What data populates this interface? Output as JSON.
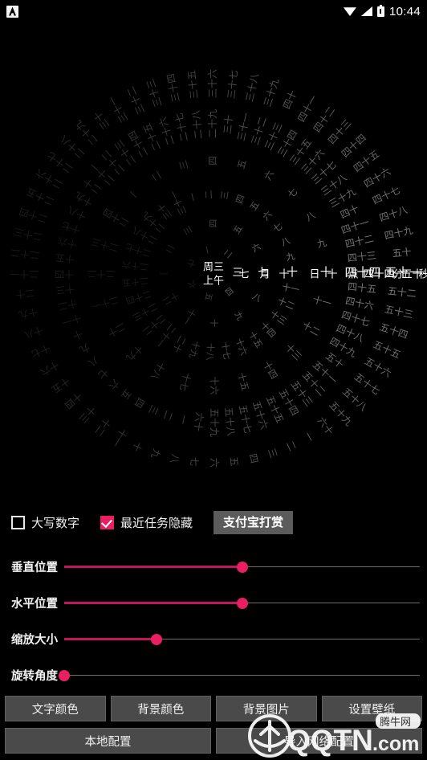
{
  "statusbar": {
    "app_icon": "app-notification-icon",
    "wifi_icon": "wifi-icon",
    "signal_icon": "signal-icon",
    "battery_icon": "battery-icon",
    "time": "10:44"
  },
  "clock": {
    "center_line1": "周三",
    "center_line2": "上午",
    "month_value": "七",
    "month_unit": "月",
    "day_value": "十",
    "day_unit": "日",
    "hour_value": "十",
    "hour_unit": "点",
    "minute_value": "四十四",
    "minute_unit": "分",
    "second_value": "五十一",
    "second_unit": "秒",
    "active_color": "#ffffff",
    "inactive_color": "#8a8a8a",
    "background": "#000000",
    "rings": [
      {
        "name": "second-ring",
        "count": 60,
        "active_index": 51,
        "radius": 236
      },
      {
        "name": "minute-ring",
        "count": 60,
        "active_index": 44,
        "radius": 186
      },
      {
        "name": "hour-ring",
        "count": 24,
        "active_index": 10,
        "radius": 140
      },
      {
        "name": "day-ring",
        "count": 31,
        "active_index": 10,
        "radius": 98
      },
      {
        "name": "month-ring",
        "count": 12,
        "active_index": 7,
        "radius": 62
      },
      {
        "name": "weekday-ring",
        "count": 7,
        "active_index": 3,
        "radius": 30
      }
    ],
    "numerals": [
      "一",
      "二",
      "三",
      "四",
      "五",
      "六",
      "七",
      "八",
      "九",
      "十",
      "十一",
      "十二",
      "十三",
      "十四",
      "十五",
      "十六",
      "十七",
      "十八",
      "十九",
      "二十",
      "二十一",
      "二十二",
      "二十三",
      "二十四",
      "二十五",
      "二十六",
      "二十七",
      "二十八",
      "二十九",
      "三十",
      "三十一",
      "三十二",
      "三十三",
      "三十四",
      "三十五",
      "三十六",
      "三十七",
      "三十八",
      "三十九",
      "四十",
      "四十一",
      "四十二",
      "四十三",
      "四十四",
      "四十五",
      "四十六",
      "四十七",
      "四十八",
      "四十九",
      "五十",
      "五十一",
      "五十二",
      "五十三",
      "五十四",
      "五十五",
      "五十六",
      "五十七",
      "五十八",
      "五十九",
      "六十"
    ]
  },
  "controls": {
    "checkbox_uppercase": {
      "label": "大写数字",
      "checked": false
    },
    "checkbox_hide_recent": {
      "label": "最近任务隐藏",
      "checked": true
    },
    "alipay_button": "支付宝打赏",
    "accent_color": "#E91E63",
    "track_color": "#C2185B"
  },
  "sliders": [
    {
      "name": "vertical-position",
      "label": "垂直位置",
      "percent": 50
    },
    {
      "name": "horizontal-position",
      "label": "水平位置",
      "percent": 50
    },
    {
      "name": "zoom-size",
      "label": "缩放大小",
      "percent": 26
    },
    {
      "name": "rotation-angle",
      "label": "旋转角度",
      "percent": 0
    }
  ],
  "buttons_row1": [
    {
      "name": "text-color-button",
      "label": "文字颜色"
    },
    {
      "name": "background-color-button",
      "label": "背景颜色"
    },
    {
      "name": "background-image-button",
      "label": "背景图片"
    },
    {
      "name": "set-wallpaper-button",
      "label": "设置壁纸"
    }
  ],
  "buttons_row2": [
    {
      "name": "local-config-button",
      "label": "本地配置"
    },
    {
      "name": "import-network-config-button",
      "label": "导入网络配置"
    }
  ],
  "watermark": {
    "site": "QQTN",
    "tld": ".com",
    "badge": "腾牛网"
  }
}
